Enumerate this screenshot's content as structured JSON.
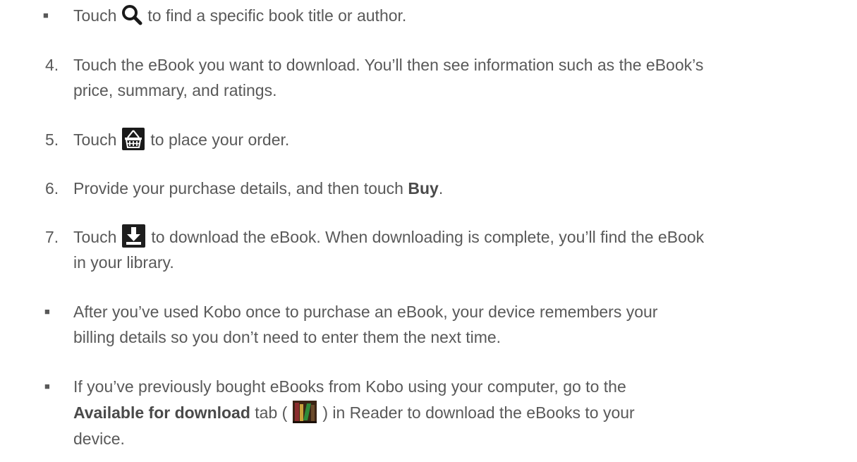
{
  "bullet_search": {
    "before": "Touch",
    "icon": "search-icon",
    "after": "to find a specific book title or author."
  },
  "step4": {
    "number": "4.",
    "line1": "Touch the eBook you want to download. You’ll then see information such as the eBook’s",
    "line2": "price, summary, and ratings."
  },
  "step5": {
    "number": "5.",
    "before": "Touch",
    "icon": "shopping-basket-icon",
    "after": "to place your order."
  },
  "step6": {
    "number": "6.",
    "before": "Provide your purchase details, and then touch",
    "bold": "Buy",
    "after": "."
  },
  "step7": {
    "number": "7.",
    "before": "Touch",
    "icon": "download-icon",
    "after": "to download the eBook. When downloading is complete, you’ll find the eBook",
    "line2": "in your library."
  },
  "bullet_kobo": {
    "line1": "After you’ve used Kobo once to purchase an eBook, your device remembers your",
    "line2": "billing details so you don’t need to enter them the next time."
  },
  "bullet_available": {
    "line1": "If you’ve previously bought eBooks from Kobo using your computer, go to the",
    "bold": "Available for download",
    "mid": "tab (",
    "icon": "library-icon",
    "after": ") in Reader to download the eBooks to your",
    "line3": "device."
  },
  "colors": {
    "text": "#595959",
    "icon_dark": "#1a1a1a",
    "icon_green": "#2e8b3a"
  }
}
